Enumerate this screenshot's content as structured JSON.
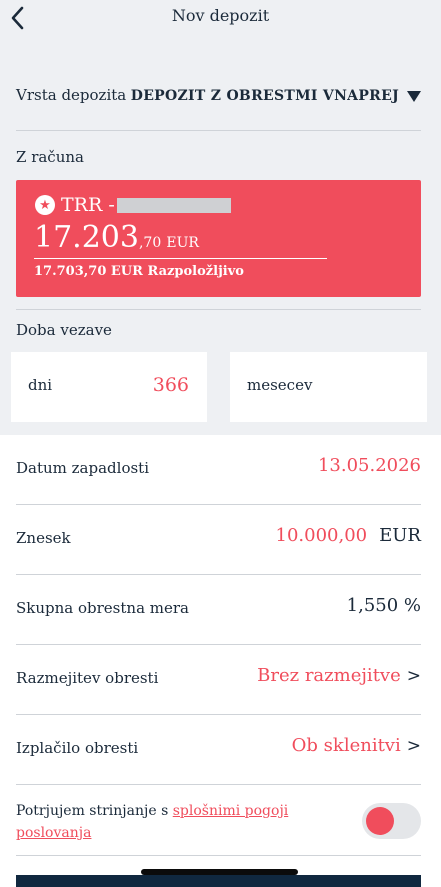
{
  "header": {
    "title": "Nov depozit",
    "back_icon": "chevron-left-icon"
  },
  "deposit_type": {
    "label": "Vrsta depozita",
    "value": "DEPOZIT Z OBRESTMI VNAPREJ"
  },
  "from_account": {
    "label": "Z računa",
    "account_prefix": "TRR -",
    "balance_whole": "17.203",
    "balance_fraction": ",70",
    "currency": "EUR",
    "available": "17.703,70 EUR Razpoložljivo",
    "card_color": "#f04d5c"
  },
  "period": {
    "label": "Doba vezave",
    "days_label": "dni",
    "days_value": "366",
    "months_label": "mesecev",
    "months_value": ""
  },
  "rows": {
    "maturity": {
      "label": "Datum zapadlosti",
      "value": "13.05.2026"
    },
    "amount": {
      "label": "Znesek",
      "value": "10.000,00",
      "currency": "EUR"
    },
    "rate": {
      "label": "Skupna obrestna mera",
      "value": "1,550 %"
    },
    "split": {
      "label": "Razmejitev obresti",
      "value": "Brez razmejitve"
    },
    "payout": {
      "label": "Izplačilo obresti",
      "value": "Ob sklenitvi"
    }
  },
  "agree": {
    "text_before": "Potrjujem strinjanje s ",
    "link": "splošnimi pogoji poslovanja"
  },
  "colors": {
    "accent": "#f04d5c",
    "text": "#1b2a3a",
    "background": "#eef0f3",
    "bottom_bar": "#10283f"
  }
}
